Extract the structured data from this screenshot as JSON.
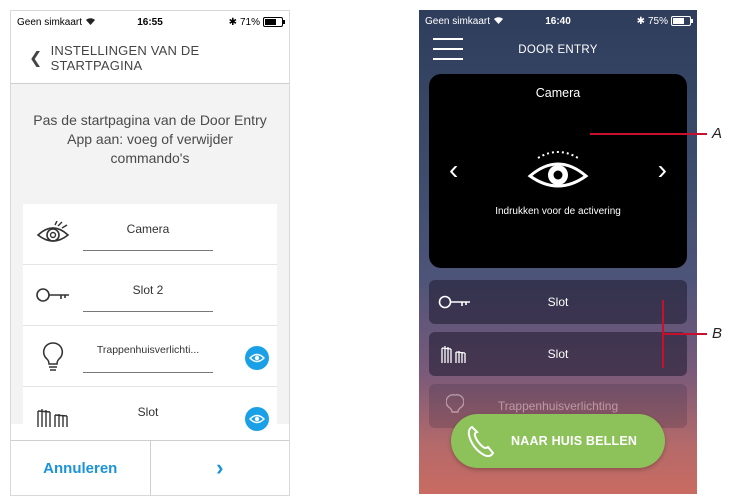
{
  "left_screen": {
    "status_bar": {
      "carrier": "Geen simkaart",
      "time": "16:55",
      "battery": "71%",
      "battery_level": 0.71
    },
    "nav": {
      "back_icon": "chevron-left-icon",
      "title": "INSTELLINGEN VAN DE STARTPAGINA"
    },
    "description": "Pas de startpagina van de Door Entry App aan: voeg of verwijder commando's",
    "items": [
      {
        "icon": "eye-icon",
        "label": "Camera",
        "visibility_toggle": false
      },
      {
        "icon": "key-icon",
        "label": "Slot 2",
        "visibility_toggle": false
      },
      {
        "icon": "lightbulb-icon",
        "label": "Trappenhuisverlichti...",
        "visibility_toggle": true
      },
      {
        "icon": "gate-icon",
        "label": "Slot",
        "visibility_toggle": true
      }
    ],
    "footer": {
      "cancel_label": "Annuleren",
      "next_label": "›"
    },
    "accent_color": "#1a93d8"
  },
  "right_screen": {
    "status_bar": {
      "carrier": "Geen simkaart",
      "time": "16:40",
      "battery": "75%",
      "battery_level": 0.75
    },
    "nav": {
      "menu_icon": "hamburger-icon",
      "title": "DOOR ENTRY"
    },
    "camera_widget": {
      "title": "Camera",
      "hint": "Indrukken voor de activering",
      "prev_label": "‹",
      "next_label": "›"
    },
    "commands": [
      {
        "icon": "key-icon",
        "label": "Slot"
      },
      {
        "icon": "gate-icon",
        "label": "Slot"
      },
      {
        "icon": "lightbulb-icon",
        "label": "Trappenhuisverlichting"
      }
    ],
    "call_button": {
      "icon": "phone-icon",
      "label": "NAAR HUIS BELLEN"
    },
    "call_color": "#8dc25a"
  },
  "callouts": {
    "a": "A",
    "b": "B",
    "color": "#c8102e"
  }
}
